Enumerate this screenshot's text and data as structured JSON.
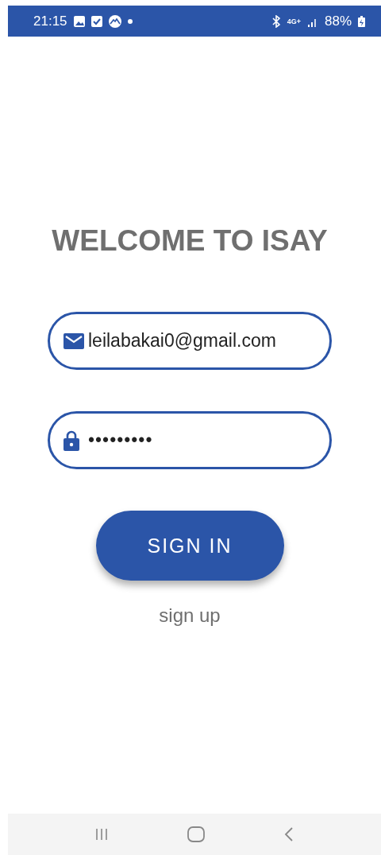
{
  "status_bar": {
    "time": "21:15",
    "network": "4G+",
    "battery": "88%"
  },
  "title": "WELCOME TO ISAY",
  "email_field": {
    "value": "leilabakai0@gmail.com"
  },
  "password_field": {
    "value": "•••••••••"
  },
  "sign_in_button": "SIGN IN",
  "sign_up_link": "sign up"
}
